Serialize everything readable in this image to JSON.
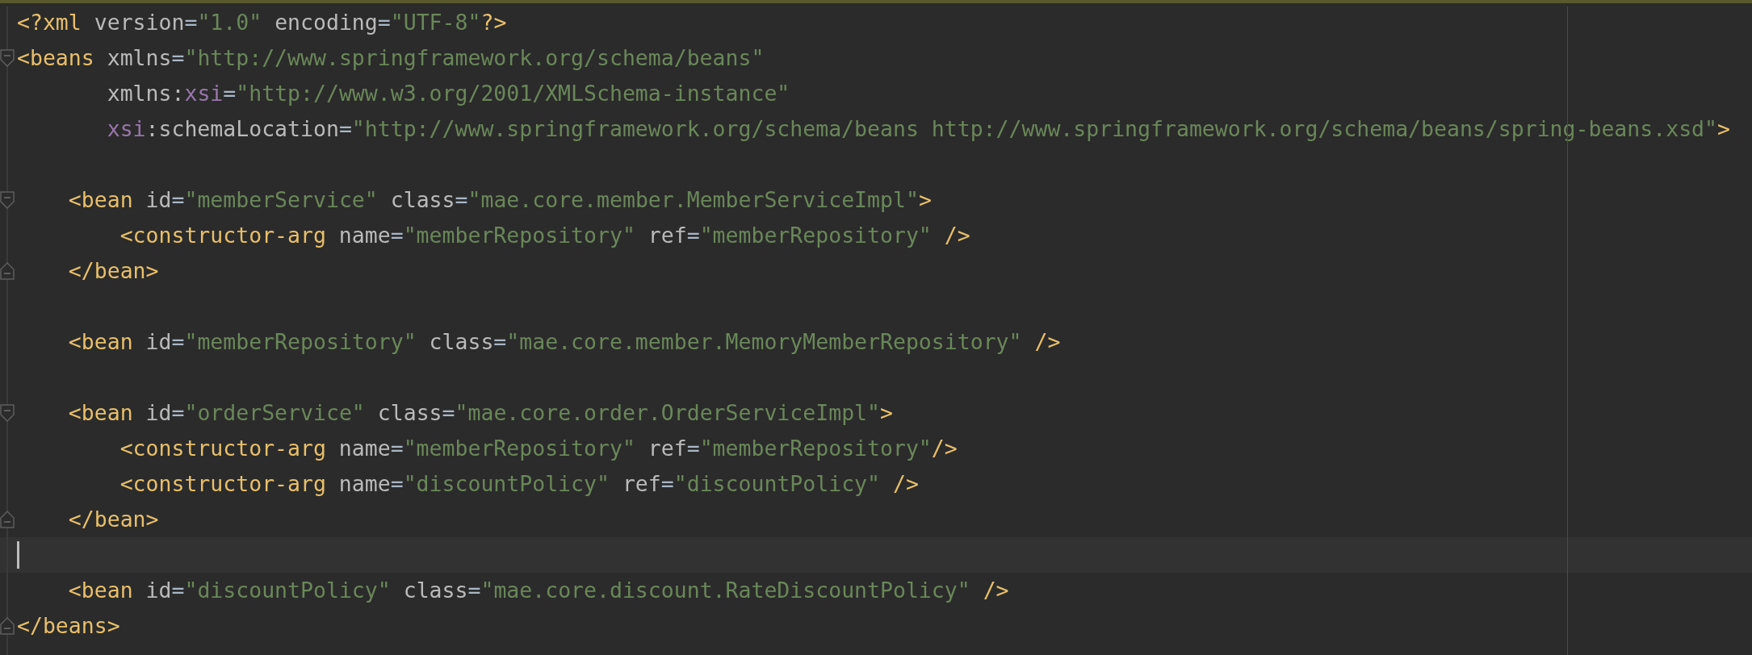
{
  "editor": {
    "lines": [
      {
        "fold_start": false,
        "fold_end": false,
        "current": false,
        "tokens": [
          {
            "kind": "tag",
            "text": "<?xml"
          },
          {
            "kind": "attr",
            "text": " version"
          },
          {
            "kind": "eq",
            "text": "="
          },
          {
            "kind": "value",
            "text": "\"1.0\""
          },
          {
            "kind": "attr",
            "text": " encoding"
          },
          {
            "kind": "eq",
            "text": "="
          },
          {
            "kind": "value",
            "text": "\"UTF-8\""
          },
          {
            "kind": "tag",
            "text": "?>"
          }
        ]
      },
      {
        "fold_start": true,
        "fold_end": false,
        "current": false,
        "tokens": [
          {
            "kind": "tag",
            "text": "<beans"
          },
          {
            "kind": "attr",
            "text": " xmlns"
          },
          {
            "kind": "eq",
            "text": "="
          },
          {
            "kind": "value",
            "text": "\"http://www.springframework.org/schema/beans\""
          }
        ]
      },
      {
        "fold_start": false,
        "fold_end": false,
        "current": false,
        "tokens": [
          {
            "kind": "attr",
            "text": "       xmlns:"
          },
          {
            "kind": "ns",
            "text": "xsi"
          },
          {
            "kind": "eq",
            "text": "="
          },
          {
            "kind": "value",
            "text": "\"http://www.w3.org/2001/XMLSchema-instance\""
          }
        ]
      },
      {
        "fold_start": false,
        "fold_end": false,
        "current": false,
        "tokens": [
          {
            "kind": "ns",
            "text": "       xsi"
          },
          {
            "kind": "attr",
            "text": ":schemaLocation"
          },
          {
            "kind": "eq",
            "text": "="
          },
          {
            "kind": "value",
            "text": "\"http://www.springframework.org/schema/beans http://www.springframework.org/schema/beans/spring-beans.xsd\""
          },
          {
            "kind": "tag",
            "text": ">"
          }
        ]
      },
      {
        "fold_start": false,
        "fold_end": false,
        "current": false
      },
      {
        "fold_start": true,
        "fold_end": false,
        "current": false,
        "tokens": [
          {
            "kind": "tag",
            "text": "    <bean"
          },
          {
            "kind": "attr",
            "text": " id"
          },
          {
            "kind": "eq",
            "text": "="
          },
          {
            "kind": "value",
            "text": "\"memberService\""
          },
          {
            "kind": "attr",
            "text": " class"
          },
          {
            "kind": "eq",
            "text": "="
          },
          {
            "kind": "value",
            "text": "\"mae.core.member.MemberServiceImpl\""
          },
          {
            "kind": "tag",
            "text": ">"
          }
        ]
      },
      {
        "fold_start": false,
        "fold_end": false,
        "current": false,
        "tokens": [
          {
            "kind": "tag",
            "text": "        <constructor-arg"
          },
          {
            "kind": "attr",
            "text": " name"
          },
          {
            "kind": "eq",
            "text": "="
          },
          {
            "kind": "value",
            "text": "\"memberRepository\""
          },
          {
            "kind": "attr",
            "text": " ref"
          },
          {
            "kind": "eq",
            "text": "="
          },
          {
            "kind": "value",
            "text": "\"memberRepository\""
          },
          {
            "kind": "tag",
            "text": " />"
          }
        ]
      },
      {
        "fold_start": false,
        "fold_end": true,
        "current": false,
        "tokens": [
          {
            "kind": "tag",
            "text": "    </bean>"
          }
        ]
      },
      {
        "fold_start": false,
        "fold_end": false,
        "current": false
      },
      {
        "fold_start": false,
        "fold_end": false,
        "current": false,
        "tokens": [
          {
            "kind": "tag",
            "text": "    <bean"
          },
          {
            "kind": "attr",
            "text": " id"
          },
          {
            "kind": "eq",
            "text": "="
          },
          {
            "kind": "value",
            "text": "\"memberRepository\""
          },
          {
            "kind": "attr",
            "text": " class"
          },
          {
            "kind": "eq",
            "text": "="
          },
          {
            "kind": "value",
            "text": "\"mae.core.member.MemoryMemberRepository\""
          },
          {
            "kind": "tag",
            "text": " />"
          }
        ]
      },
      {
        "fold_start": false,
        "fold_end": false,
        "current": false
      },
      {
        "fold_start": true,
        "fold_end": false,
        "current": false,
        "tokens": [
          {
            "kind": "tag",
            "text": "    <bean"
          },
          {
            "kind": "attr",
            "text": " id"
          },
          {
            "kind": "eq",
            "text": "="
          },
          {
            "kind": "value",
            "text": "\"orderService\""
          },
          {
            "kind": "attr",
            "text": " class"
          },
          {
            "kind": "eq",
            "text": "="
          },
          {
            "kind": "value",
            "text": "\"mae.core.order.OrderServiceImpl\""
          },
          {
            "kind": "tag",
            "text": ">"
          }
        ]
      },
      {
        "fold_start": false,
        "fold_end": false,
        "current": false,
        "tokens": [
          {
            "kind": "tag",
            "text": "        <constructor-arg"
          },
          {
            "kind": "attr",
            "text": " name"
          },
          {
            "kind": "eq",
            "text": "="
          },
          {
            "kind": "value",
            "text": "\"memberRepository\""
          },
          {
            "kind": "attr",
            "text": " ref"
          },
          {
            "kind": "eq",
            "text": "="
          },
          {
            "kind": "value",
            "text": "\"memberRepository\""
          },
          {
            "kind": "tag",
            "text": "/>"
          }
        ]
      },
      {
        "fold_start": false,
        "fold_end": false,
        "current": false,
        "tokens": [
          {
            "kind": "tag",
            "text": "        <constructor-arg"
          },
          {
            "kind": "attr",
            "text": " name"
          },
          {
            "kind": "eq",
            "text": "="
          },
          {
            "kind": "value",
            "text": "\"discountPolicy\""
          },
          {
            "kind": "attr",
            "text": " ref"
          },
          {
            "kind": "eq",
            "text": "="
          },
          {
            "kind": "value",
            "text": "\"discountPolicy\""
          },
          {
            "kind": "tag",
            "text": " />"
          }
        ]
      },
      {
        "fold_start": false,
        "fold_end": true,
        "current": false,
        "tokens": [
          {
            "kind": "tag",
            "text": "    </bean>"
          }
        ]
      },
      {
        "fold_start": false,
        "fold_end": false,
        "current": true
      },
      {
        "fold_start": false,
        "fold_end": false,
        "current": false,
        "tokens": [
          {
            "kind": "tag",
            "text": "    <bean"
          },
          {
            "kind": "attr",
            "text": " id"
          },
          {
            "kind": "eq",
            "text": "="
          },
          {
            "kind": "value",
            "text": "\"discountPolicy\""
          },
          {
            "kind": "attr",
            "text": " class"
          },
          {
            "kind": "eq",
            "text": "="
          },
          {
            "kind": "value",
            "text": "\"mae.core.discount.RateDiscountPolicy\""
          },
          {
            "kind": "tag",
            "text": " />"
          }
        ]
      },
      {
        "fold_start": false,
        "fold_end": true,
        "current": false,
        "tokens": [
          {
            "kind": "tag",
            "text": "</beans>"
          }
        ]
      }
    ]
  }
}
